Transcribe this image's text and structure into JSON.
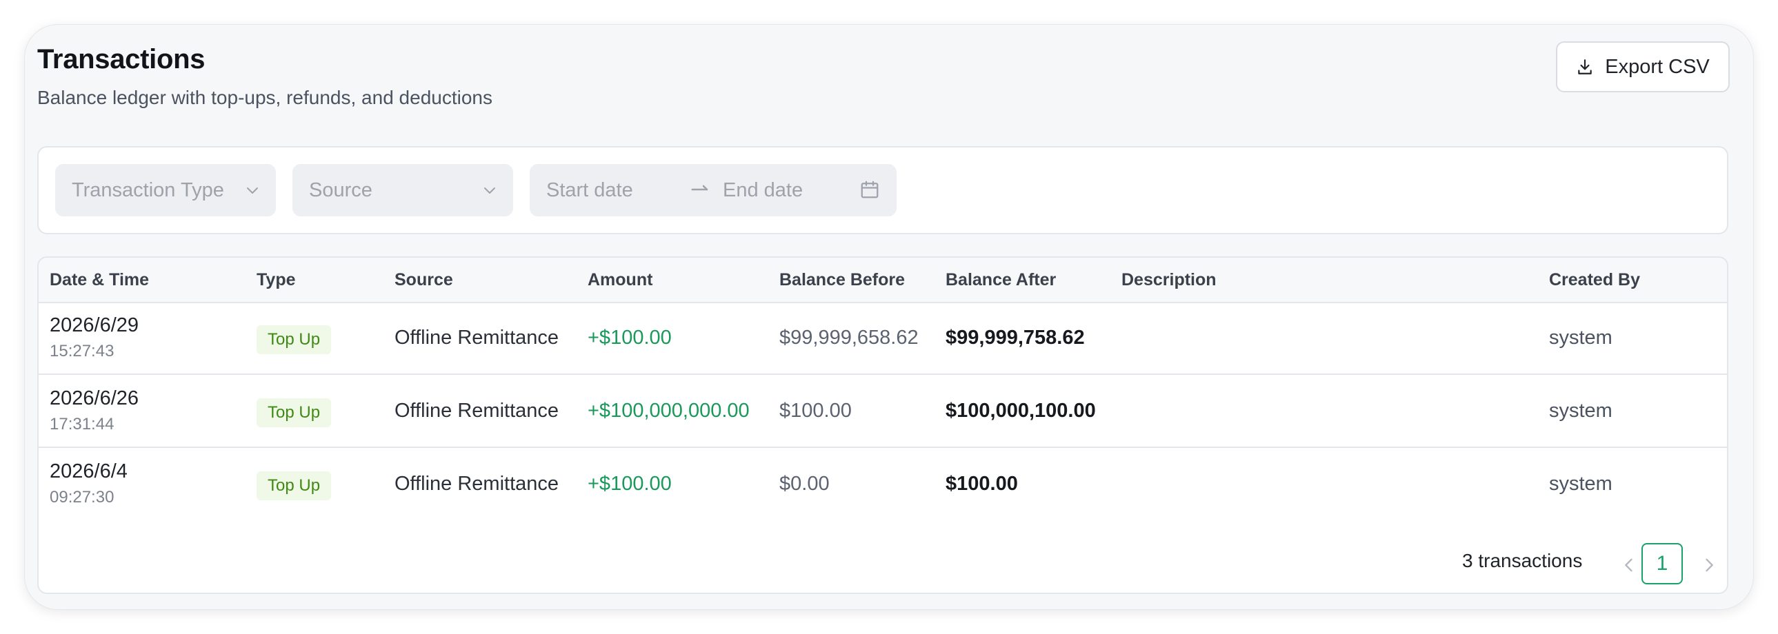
{
  "header": {
    "title": "Transactions",
    "subtitle": "Balance ledger with top-ups, refunds, and deductions",
    "export_label": "Export CSV",
    "export_icon": "download-icon"
  },
  "filters": {
    "type_placeholder": "Transaction Type",
    "source_placeholder": "Source",
    "start_placeholder": "Start date",
    "end_placeholder": "End date",
    "arrow_icon": "arrow-right-icon",
    "calendar_icon": "calendar-icon"
  },
  "table": {
    "columns": [
      "Date & Time",
      "Type",
      "Source",
      "Amount",
      "Balance Before",
      "Balance After",
      "Description",
      "Created By"
    ],
    "rows": [
      {
        "date": "2026/6/29",
        "time": "15:27:43",
        "type": "Top Up",
        "source": "Offline Remittance",
        "amount": "+$100.00",
        "before": "$99,999,658.62",
        "after": "$99,999,758.62",
        "description": "",
        "created_by": "system"
      },
      {
        "date": "2026/6/26",
        "time": "17:31:44",
        "type": "Top Up",
        "source": "Offline Remittance",
        "amount": "+$100,000,000.00",
        "before": "$100.00",
        "after": "$100,000,100.00",
        "description": "",
        "created_by": "system"
      },
      {
        "date": "2026/6/4",
        "time": "09:27:30",
        "type": "Top Up",
        "source": "Offline Remittance",
        "amount": "+$100.00",
        "before": "$0.00",
        "after": "$100.00",
        "description": "",
        "created_by": "system"
      }
    ]
  },
  "pagination": {
    "summary": "3 transactions",
    "current_page": "1"
  },
  "colors": {
    "accent": "#1aa06a",
    "badge_bg": "#f0f9e8",
    "badge_text": "#3e8a14"
  }
}
